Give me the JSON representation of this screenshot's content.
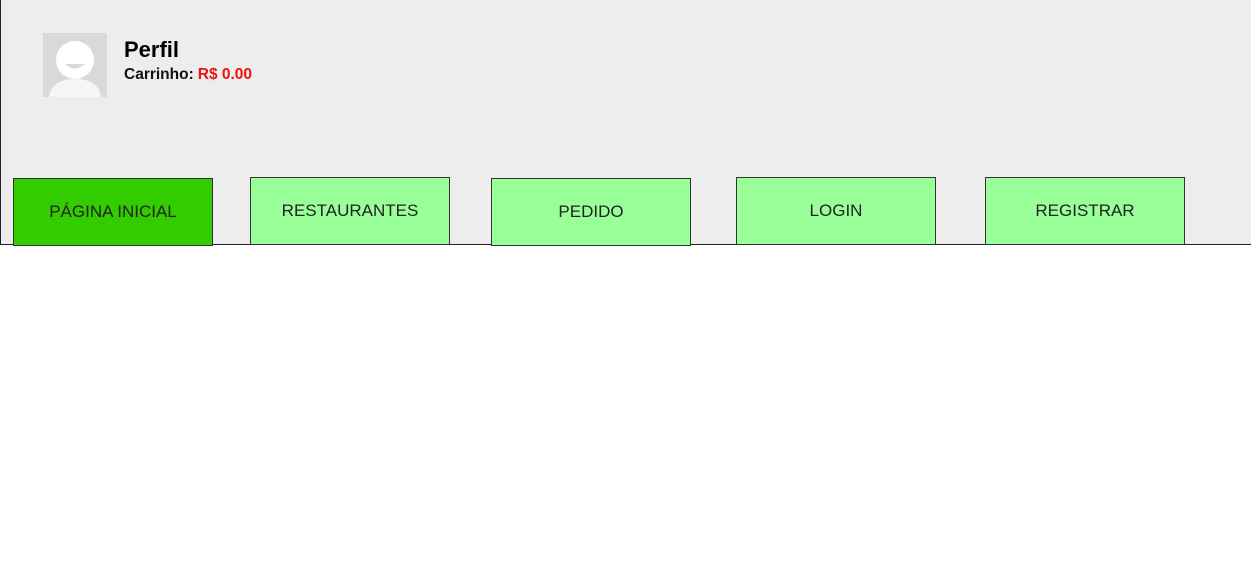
{
  "profile": {
    "title": "Perfil",
    "cart_label": "Carrinho:",
    "cart_value": "R$ 0.00",
    "avatar_icon": "user-avatar-icon"
  },
  "nav": {
    "items": [
      {
        "label": "PÁGINA INICIAL",
        "active": true
      },
      {
        "label": "RESTAURANTES",
        "active": false
      },
      {
        "label": "PEDIDO",
        "active": false
      },
      {
        "label": "LOGIN",
        "active": false
      },
      {
        "label": "REGISTRAR",
        "active": false
      }
    ]
  },
  "colors": {
    "header_bg": "#ededed",
    "button": "#99ff99",
    "button_active": "#33cc00",
    "cart_value": "#ee1111"
  }
}
